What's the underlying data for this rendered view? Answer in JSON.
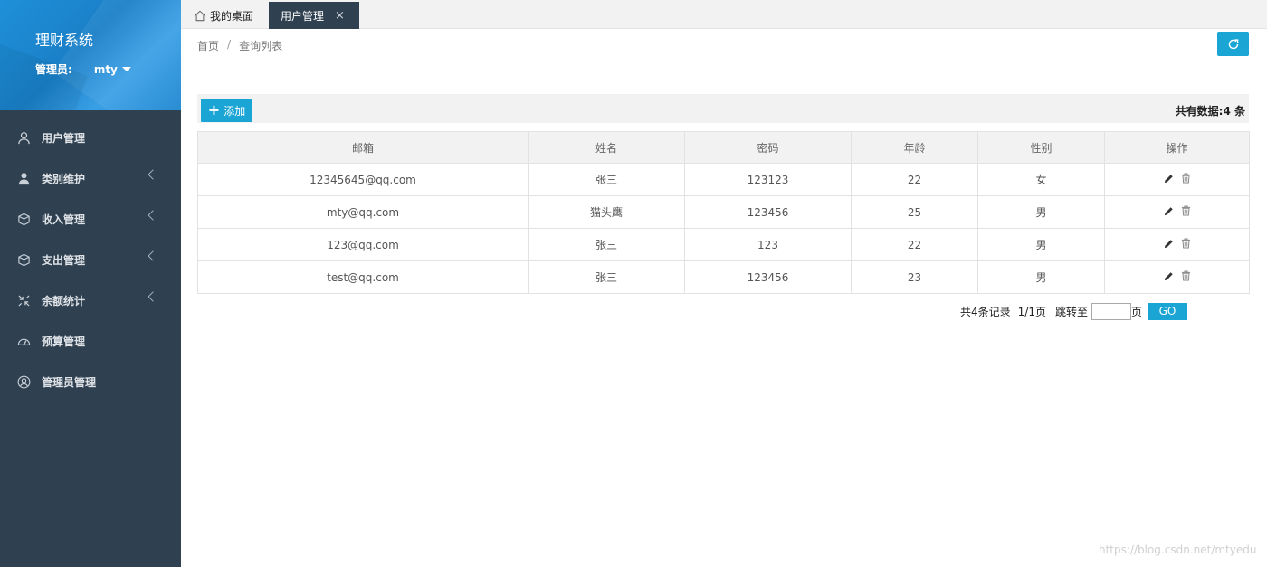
{
  "sidebar": {
    "title": "理财系统",
    "user_label": "管理员:",
    "user_name": "mty",
    "items": [
      {
        "label": "用户管理",
        "icon": "user-outline-icon",
        "expandable": false
      },
      {
        "label": "类别维护",
        "icon": "user-solid-icon",
        "expandable": true
      },
      {
        "label": "收入管理",
        "icon": "cube-icon",
        "expandable": true
      },
      {
        "label": "支出管理",
        "icon": "cube-icon",
        "expandable": true
      },
      {
        "label": "余额统计",
        "icon": "compress-icon",
        "expandable": true
      },
      {
        "label": "预算管理",
        "icon": "gauge-icon",
        "expandable": false
      },
      {
        "label": "管理员管理",
        "icon": "user-circle-icon",
        "expandable": false
      }
    ]
  },
  "tabs": {
    "home": "我的桌面",
    "active": "用户管理",
    "close_glyph": "×"
  },
  "breadcrumb": {
    "home": "首页",
    "separator": "/",
    "current": "查询列表"
  },
  "toolbar": {
    "add_label": "添加",
    "total_label": "共有数据:4 条"
  },
  "table": {
    "columns": [
      "邮箱",
      "姓名",
      "密码",
      "年龄",
      "性别",
      "操作"
    ],
    "rows": [
      {
        "email": "12345645@qq.com",
        "name": "张三",
        "password": "123123",
        "age": "22",
        "gender": "女"
      },
      {
        "email": "mty@qq.com",
        "name": "猫头鹰",
        "password": "123456",
        "age": "25",
        "gender": "男"
      },
      {
        "email": "123@qq.com",
        "name": "张三",
        "password": "123",
        "age": "22",
        "gender": "男"
      },
      {
        "email": "test@qq.com",
        "name": "张三",
        "password": "123456",
        "age": "23",
        "gender": "男"
      }
    ]
  },
  "pager": {
    "count_text": "共4条记录",
    "page_text": "1/1页",
    "jump_label": "跳转至",
    "page_suffix": "页",
    "jump_value": "",
    "go_label": "GO"
  },
  "watermark": "https://blog.csdn.net/mtyedu",
  "colors": {
    "sidebar_bg": "#2f4050",
    "accent": "#1aa5d5",
    "brand_blue": "#1e90d9"
  }
}
